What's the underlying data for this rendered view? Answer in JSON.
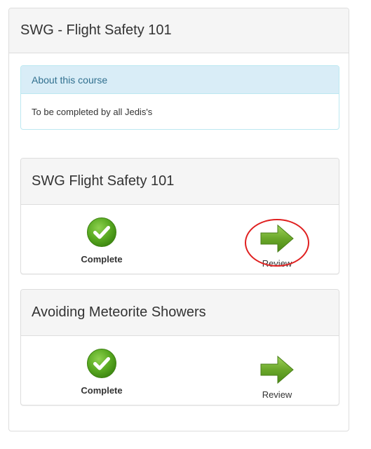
{
  "course": {
    "title": "SWG - Flight Safety 101"
  },
  "about": {
    "heading": "About this course",
    "body": "To be completed by all Jedis's"
  },
  "modules": [
    {
      "title": "SWG Flight Safety 101",
      "status_label": "Complete",
      "status_icon": "check-circle-icon",
      "action_label": "Review",
      "action_icon": "arrow-right-icon",
      "highlighted": true
    },
    {
      "title": "Avoiding Meteorite Showers",
      "status_label": "Complete",
      "status_icon": "check-circle-icon",
      "action_label": "Review",
      "action_icon": "arrow-right-icon",
      "highlighted": false
    }
  ],
  "colors": {
    "panel_header_bg": "#f5f5f5",
    "info_header_bg": "#d9edf7",
    "info_text": "#31708f",
    "check_green": "#5cb02d",
    "arrow_green": "#6fae2a",
    "highlight_ring": "#e02020"
  }
}
